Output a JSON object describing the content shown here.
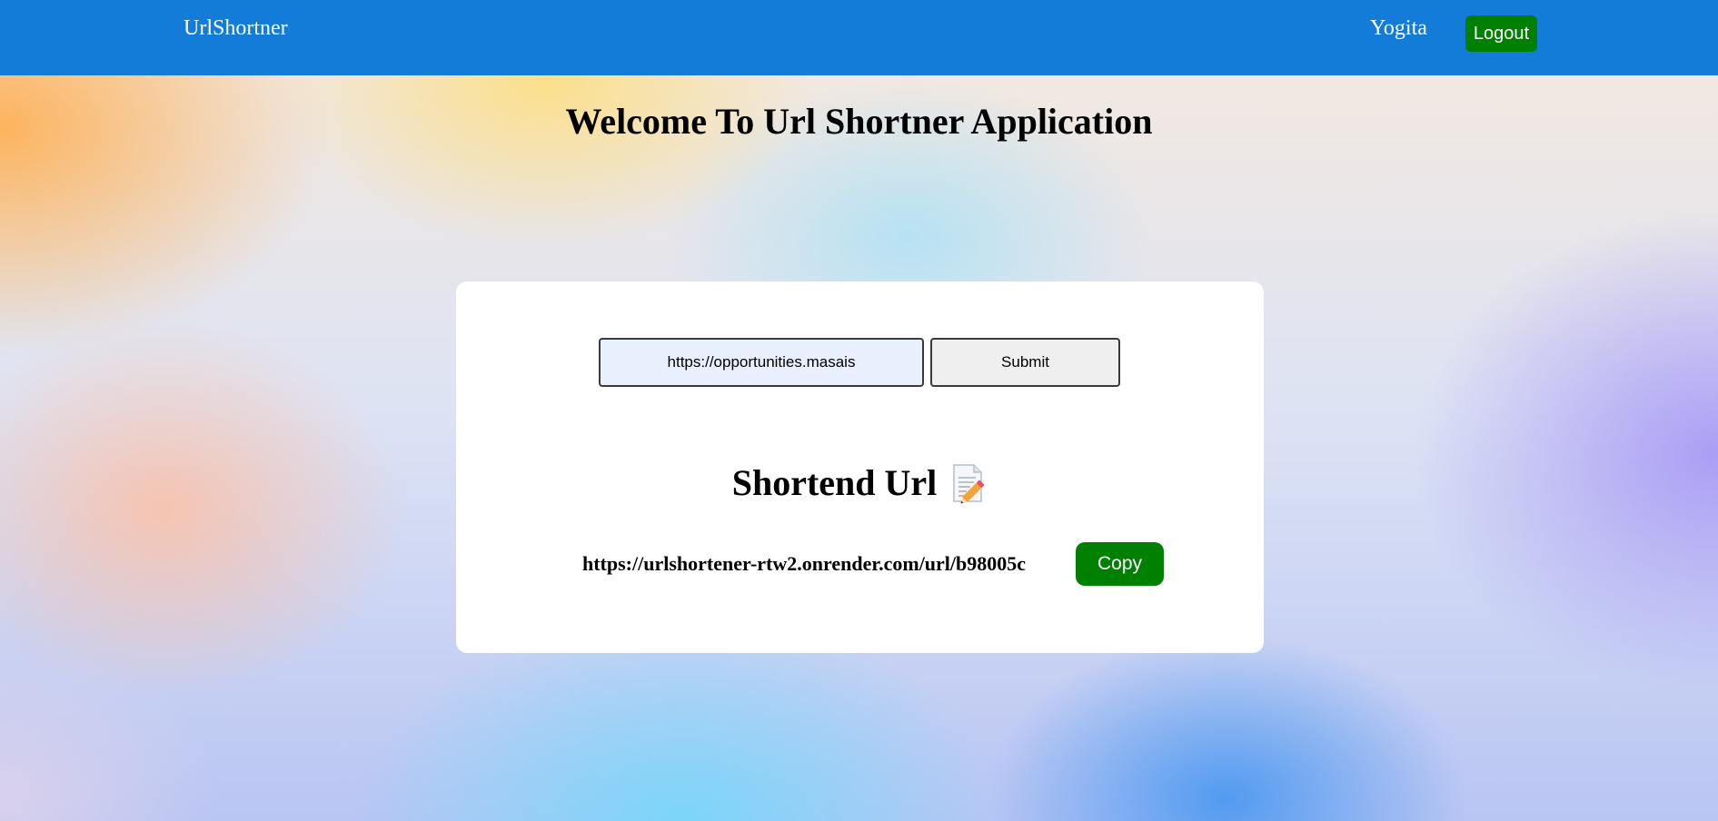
{
  "navbar": {
    "brand": "UrlShortner",
    "username": "Yogita",
    "logout_label": "Logout"
  },
  "main": {
    "title": "Welcome To Url Shortner Application"
  },
  "form": {
    "url_value": "https://opportunities.masais",
    "submit_label": "Submit"
  },
  "result": {
    "heading": "Shortend Url",
    "heading_icon": "memo-icon",
    "short_url": "https://urlshortener-rtw2.onrender.com/url/b98005c",
    "copy_label": "Copy"
  },
  "colors": {
    "navbar": "#127cd8",
    "button_green": "#008000",
    "input_bg": "#e8f0fe"
  }
}
